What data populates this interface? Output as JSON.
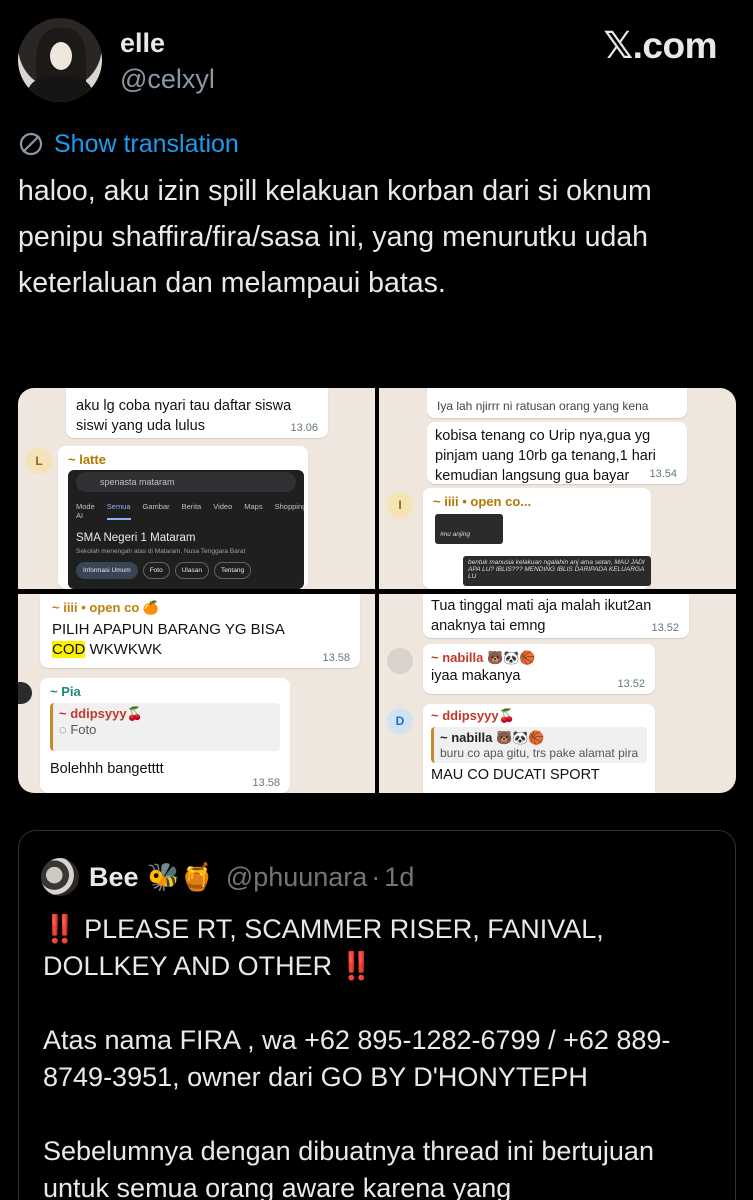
{
  "author": {
    "display_name": "elle",
    "handle": "@celxyl"
  },
  "brand": "𝕏.com",
  "translation": {
    "label": "Show translation",
    "icon": "globe-icon"
  },
  "tweet": {
    "text": "haloo, aku izin spill kelakuan korban dari si oknum penipu shaffira/fira/sasa ini, yang menurutku udah keterlaluan dan melampaui batas."
  },
  "media": {
    "tile1": {
      "msg1": "aku lg coba nyari tau daftar siswa siswi yang uda lulus",
      "msg1_time": "13.06",
      "avatar_letter": "L",
      "sender": "~ latte",
      "search_query": "spenasta mataram",
      "tabs": [
        "Mode AI",
        "Semua",
        "Gambar",
        "Berita",
        "Video",
        "Maps",
        "Shopping"
      ],
      "result_title": "SMA Negeri 1 Mataram",
      "result_sub": "Sekolah menengah atas di Mataram, Nusa Tenggara Barat",
      "chips": [
        "Informasi Umum",
        "Foto",
        "Ulasan",
        "Tentang"
      ]
    },
    "tile2": {
      "msg0": "Iya lah njirrr ni ratusan orang yang kena",
      "msg1": "kobisa tenang co Urip nya,gua yg pinjam uang 10rb ga tenang,1 hari kemudian langsung gua bayar",
      "msg1_time": "13.54",
      "avatar_letter": "I",
      "sender": "~ iiii • open co...",
      "inner1": "#nu anjing",
      "inner2": "bentuk manusia kelakuan ngalahin anj ama setan, MAU JADI APA LU? IBLIS??? MENDING IBLIS DARIPADA KELUARGA LU"
    },
    "tile3": {
      "sender": "~ iiii • open co 🍊",
      "msg1": "PILIH APAPUN BARANG YG BISA",
      "msg1_hl": "COD",
      "msg1_rest": "WKWKWK",
      "msg1_time": "13.58",
      "sender2": "~ Pia",
      "quote_sender": "~ ddipsyyy🍒",
      "quote_body": "Foto",
      "msg2": "Bolehhh bangetttt",
      "msg2_time": "13.58"
    },
    "tile4": {
      "msg1": "Tua tinggal mati aja malah ikut2an anaknya tai emng",
      "msg1_time": "13.52",
      "sender2": "~ nabilla 🐻🐼🏀",
      "msg2": "iyaa makanya",
      "msg2_time": "13.52",
      "avatar_letter": "D",
      "sender3": "~ ddipsyyy🍒",
      "quote_sender": "~ nabilla 🐻🐼🏀",
      "quote_body": "buru co apa gitu, trs pake alamat pira",
      "msg3": "MAU CO DUCATI SPORT"
    }
  },
  "quote_tweet": {
    "name": "Bee",
    "emoji": "🐝🍯",
    "handle": "@phuunara",
    "dot": "·",
    "time": "1d",
    "bang": "‼️",
    "line1": "PLEASE RT, SCAMMER RISER, FANIVAL, DOLLKEY AND OTHER",
    "para2": "Atas nama FIRA , wa +62 895-1282-6799 / +62 889-8749-3951, owner dari GO BY D'HONYTEPH",
    "para3": "Sebelumnya dengan dibuatnya thread ini bertujuan untuk semua orang aware karena yang"
  },
  "colors": {
    "link": "#1d9bf0",
    "muted": "#8b98a5",
    "chat_bg": "#efe7dd",
    "alert": "#e0262a"
  }
}
